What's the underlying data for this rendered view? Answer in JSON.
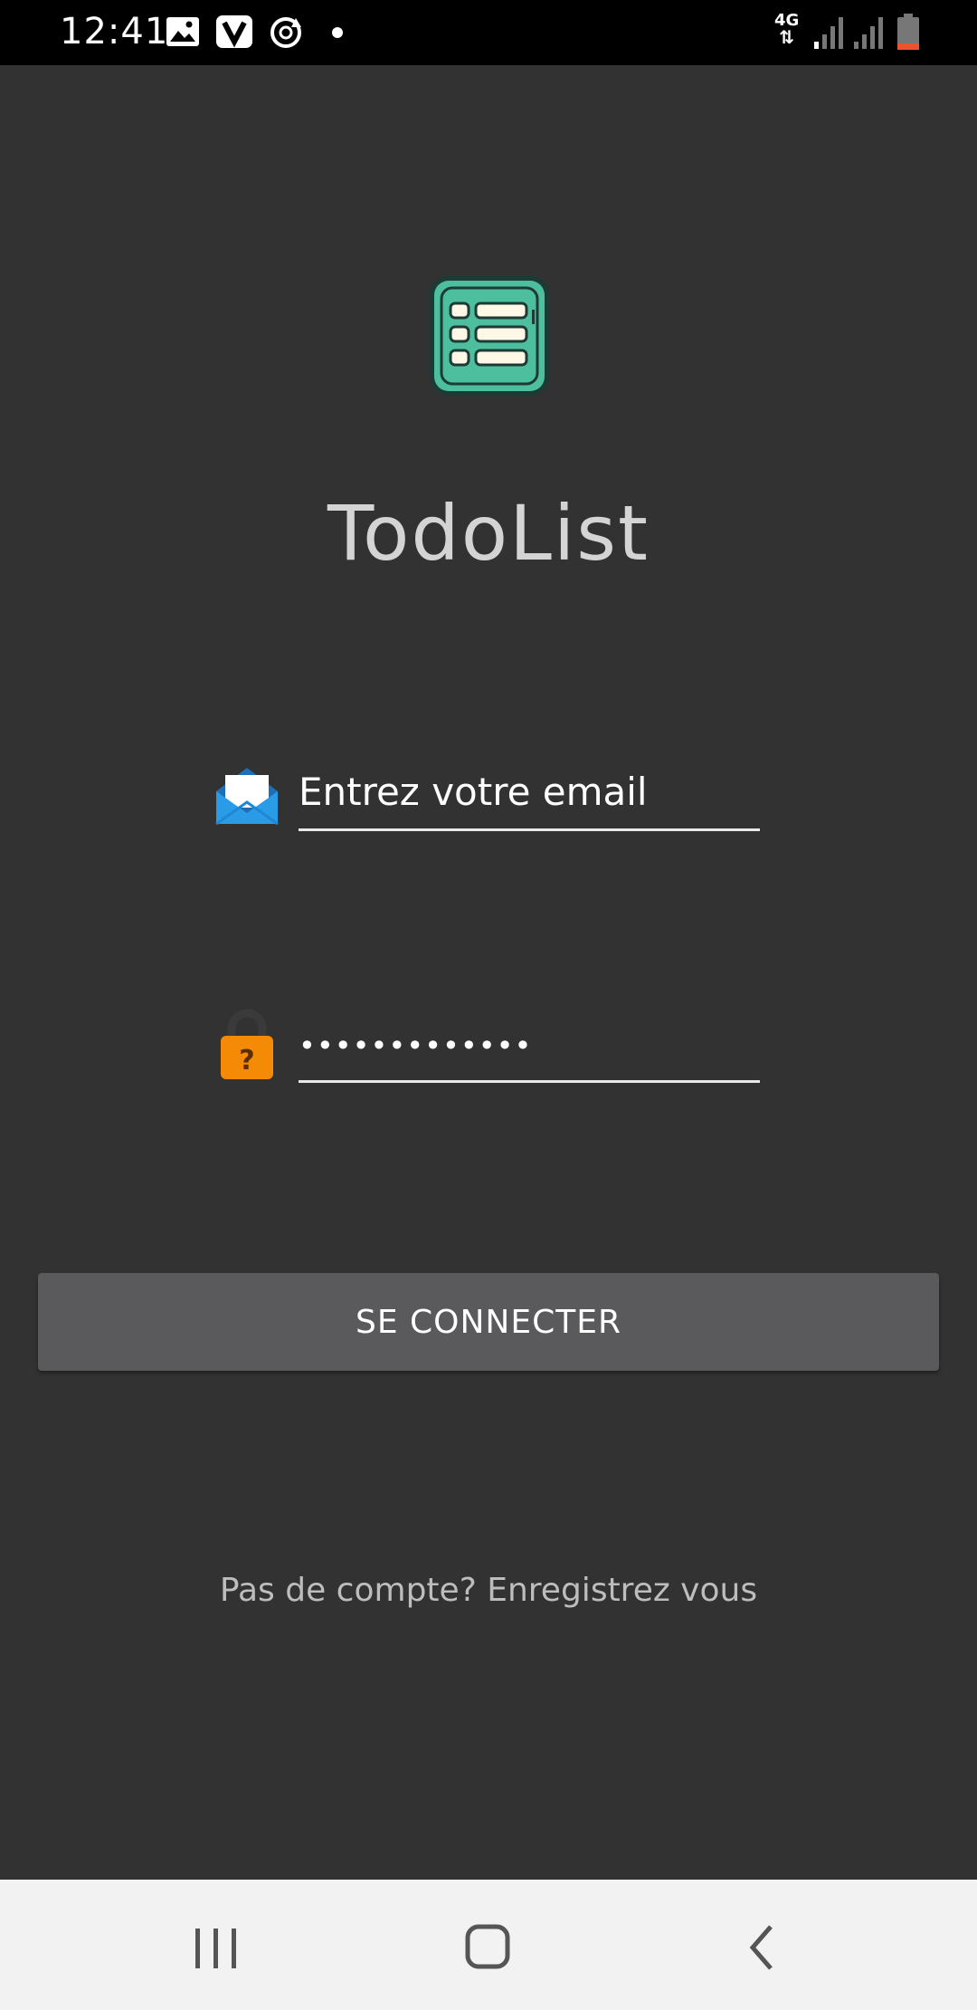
{
  "status_bar": {
    "time": "12:41",
    "network": "4G",
    "icons": [
      "gallery-icon",
      "v-app-icon",
      "sync-icon",
      "notification-dot",
      "network-4g-icon",
      "signal-icon",
      "signal-icon",
      "battery-icon"
    ]
  },
  "app": {
    "title": "TodoList",
    "logo_icon": "list-logo-icon",
    "accent_color": "#4dbf9f"
  },
  "login_form": {
    "email_placeholder": "Entrez votre email",
    "email_icon": "envelope-icon",
    "password_value": "•••••••••••••",
    "password_icon": "lock-icon",
    "submit_label": "SE CONNECTER",
    "register_prompt": "Pas de compte? Enregistrez vous"
  },
  "nav_bar": {
    "buttons": [
      "recents-icon",
      "home-icon",
      "back-icon"
    ]
  }
}
